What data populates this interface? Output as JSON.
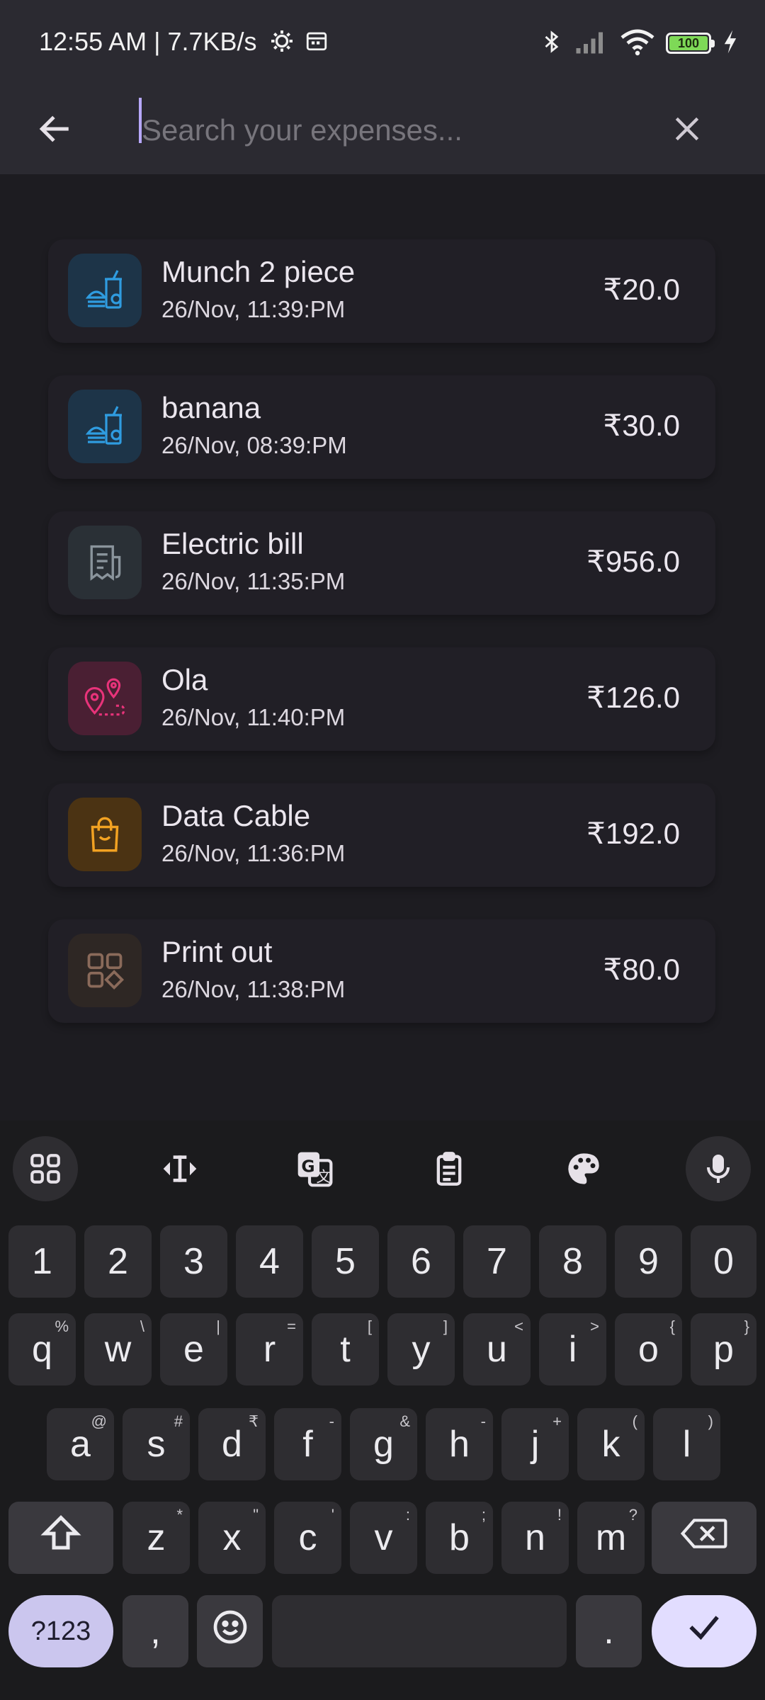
{
  "status_bar": {
    "time_text": "12:55 AM | 7.7KB/s",
    "battery_level": "100",
    "icons": [
      "gear-icon",
      "calendar-icon",
      "bluetooth-icon",
      "signal-icon",
      "wifi-icon",
      "battery-icon",
      "charging-bolt-icon"
    ]
  },
  "search": {
    "placeholder": "Search your expenses...",
    "value": ""
  },
  "expenses": [
    {
      "title": "Munch 2 piece",
      "date": "26/Nov, 11:39:PM",
      "amount": "₹20.0",
      "icon": "food-icon",
      "color": "#2f9ce0"
    },
    {
      "title": "banana",
      "date": "26/Nov, 08:39:PM",
      "amount": "₹30.0",
      "icon": "food-icon",
      "color": "#2f9ce0"
    },
    {
      "title": "Electric bill",
      "date": "26/Nov, 11:35:PM",
      "amount": "₹956.0",
      "icon": "receipt-icon",
      "color": "#8a949c"
    },
    {
      "title": "Ola",
      "date": "26/Nov, 11:40:PM",
      "amount": "₹126.0",
      "icon": "route-pin-icon",
      "color": "#e8337a"
    },
    {
      "title": "Data Cable",
      "date": "26/Nov, 11:36:PM",
      "amount": "₹192.0",
      "icon": "shopping-bag-icon",
      "color": "#f2a222"
    },
    {
      "title": "Print out",
      "date": "26/Nov, 11:38:PM",
      "amount": "₹80.0",
      "icon": "category-grid-icon",
      "color": "#8a6a5a"
    }
  ],
  "keyboard": {
    "toolbar_icons": [
      "apps-grid-icon",
      "text-cursor-icon",
      "translate-icon",
      "clipboard-icon",
      "palette-icon",
      "microphone-icon"
    ],
    "number_row": [
      "1",
      "2",
      "3",
      "4",
      "5",
      "6",
      "7",
      "8",
      "9",
      "0"
    ],
    "row1": [
      {
        "key": "q",
        "hint": "%"
      },
      {
        "key": "w",
        "hint": "\\"
      },
      {
        "key": "e",
        "hint": "|"
      },
      {
        "key": "r",
        "hint": "="
      },
      {
        "key": "t",
        "hint": "["
      },
      {
        "key": "y",
        "hint": "]"
      },
      {
        "key": "u",
        "hint": "<"
      },
      {
        "key": "i",
        "hint": ">"
      },
      {
        "key": "o",
        "hint": "{"
      },
      {
        "key": "p",
        "hint": "}"
      }
    ],
    "row2": [
      {
        "key": "a",
        "hint": "@"
      },
      {
        "key": "s",
        "hint": "#"
      },
      {
        "key": "d",
        "hint": "₹"
      },
      {
        "key": "f",
        "hint": "-"
      },
      {
        "key": "g",
        "hint": "&"
      },
      {
        "key": "h",
        "hint": "-"
      },
      {
        "key": "j",
        "hint": "+"
      },
      {
        "key": "k",
        "hint": "("
      },
      {
        "key": "l",
        "hint": ")"
      }
    ],
    "row3": [
      {
        "key": "z",
        "hint": "*"
      },
      {
        "key": "x",
        "hint": "\""
      },
      {
        "key": "c",
        "hint": "'"
      },
      {
        "key": "v",
        "hint": ":"
      },
      {
        "key": "b",
        "hint": ";"
      },
      {
        "key": "n",
        "hint": "!"
      },
      {
        "key": "m",
        "hint": "?"
      }
    ],
    "symbols_label": "?123",
    "comma_label": ",",
    "period_label": "."
  }
}
